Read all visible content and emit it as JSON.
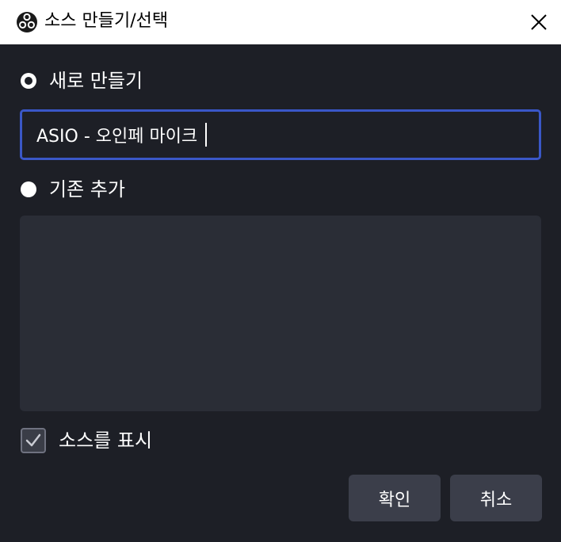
{
  "window": {
    "title": "소스 만들기/선택",
    "app_icon": "obs-logo-icon",
    "close_icon": "close-icon"
  },
  "create_new": {
    "label": "새로 만들기",
    "selected": true
  },
  "name_input": {
    "value": "ASIO - 오인페 마이크"
  },
  "add_existing": {
    "label": "기존 추가",
    "selected": false,
    "items": []
  },
  "show_source": {
    "label": "소스를 표시",
    "checked": true
  },
  "buttons": {
    "ok_label": "확인",
    "cancel_label": "취소"
  },
  "colors": {
    "background": "#1d1f26",
    "list_background": "#2a2d36",
    "input_focus_border": "#3a57c7",
    "button_background": "#3b3e4a",
    "titlebar_background": "#ffffff"
  }
}
